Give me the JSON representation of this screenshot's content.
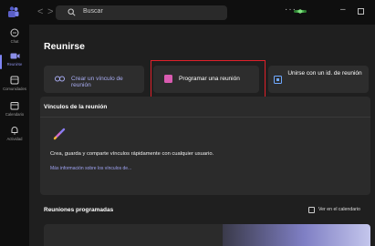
{
  "titlebar": {
    "nav_back": "<",
    "nav_forward": ">",
    "search_placeholder": "Buscar",
    "more": "···",
    "minimize": "–"
  },
  "rail": {
    "items": [
      {
        "label": "Chat",
        "icon": "chat-icon"
      },
      {
        "label": "Reunirse",
        "icon": "video-camera-icon",
        "active": true
      },
      {
        "label": "Comunidades",
        "icon": "communities-icon"
      },
      {
        "label": "Calendario",
        "icon": "calendar-icon"
      },
      {
        "label": "Actividad",
        "icon": "bell-icon"
      }
    ]
  },
  "main": {
    "heading": "Reunirse",
    "create_link_label": "Crear un vínculo de reunión",
    "schedule_label": "Programar una reunión",
    "join_label": "Unirse con un id. de reunión",
    "links_title": "Vínculos de la reunión",
    "links_desc": "Crea, guarda y comparte vínculos rápidamente con cualquier usuario.",
    "links_more": "Más información sobre los vínculos de...",
    "scheduled_title": "Reuniones programadas",
    "calendar_link": "Ver en el calendario"
  },
  "colors": {
    "accent": "#7f85f5",
    "highlight_border": "#e0202a",
    "schedule_icon": "#d95bb0"
  }
}
